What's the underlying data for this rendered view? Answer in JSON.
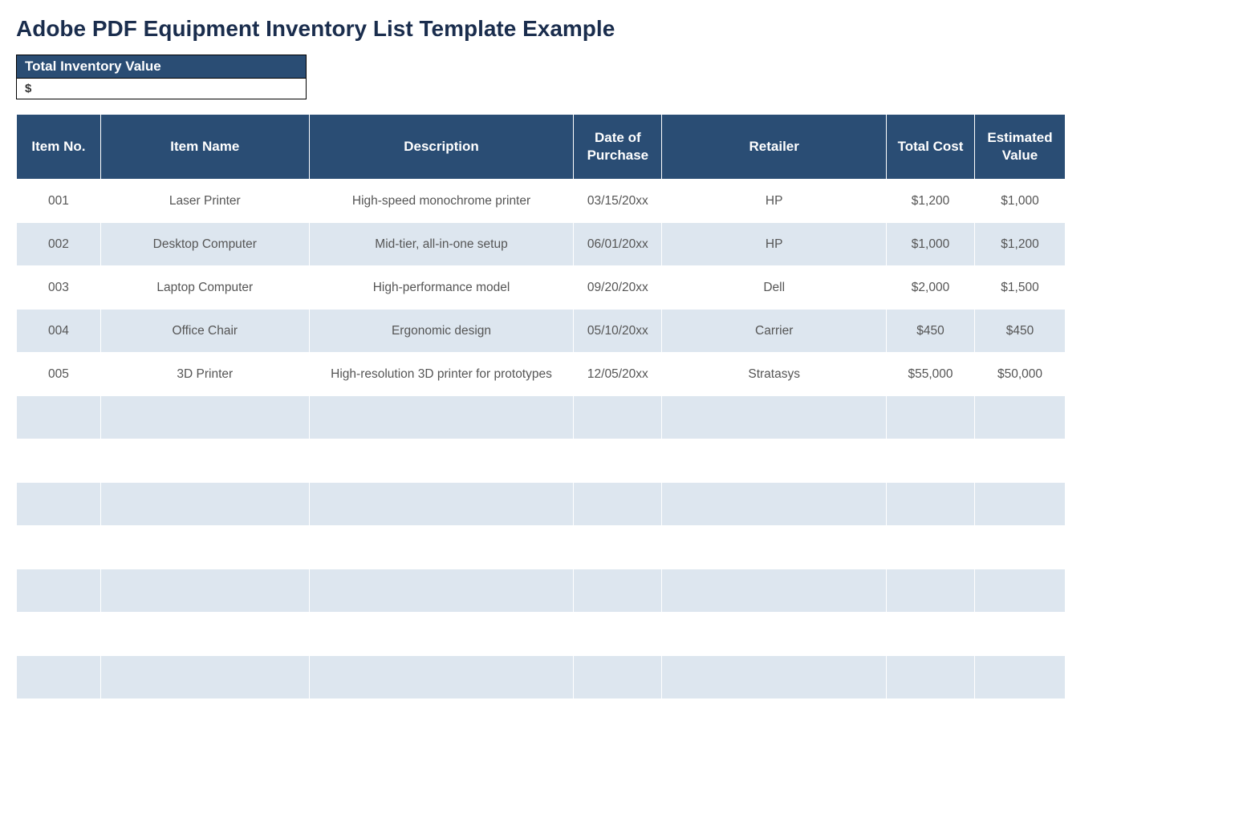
{
  "title": "Adobe PDF Equipment Inventory List Template Example",
  "total": {
    "label": "Total Inventory Value",
    "value": "$"
  },
  "columns": [
    "Item No.",
    "Item Name",
    "Description",
    "Date of Purchase",
    "Retailer",
    "Total Cost",
    "Estimated Value"
  ],
  "rows": [
    {
      "item_no": "001",
      "item_name": "Laser Printer",
      "description": "High-speed monochrome printer",
      "date": "03/15/20xx",
      "retailer": "HP",
      "cost": "$1,200",
      "est": "$1,000"
    },
    {
      "item_no": "002",
      "item_name": "Desktop Computer",
      "description": "Mid-tier, all-in-one setup",
      "date": "06/01/20xx",
      "retailer": "HP",
      "cost": "$1,000",
      "est": "$1,200"
    },
    {
      "item_no": "003",
      "item_name": "Laptop Computer",
      "description": "High-performance model",
      "date": "09/20/20xx",
      "retailer": "Dell",
      "cost": "$2,000",
      "est": "$1,500"
    },
    {
      "item_no": "004",
      "item_name": "Office Chair",
      "description": "Ergonomic design",
      "date": "05/10/20xx",
      "retailer": "Carrier",
      "cost": "$450",
      "est": "$450"
    },
    {
      "item_no": "005",
      "item_name": "3D Printer",
      "description": "High-resolution 3D printer for prototypes",
      "date": "12/05/20xx",
      "retailer": "Stratasys",
      "cost": "$55,000",
      "est": "$50,000"
    }
  ],
  "empty_rows": 7
}
